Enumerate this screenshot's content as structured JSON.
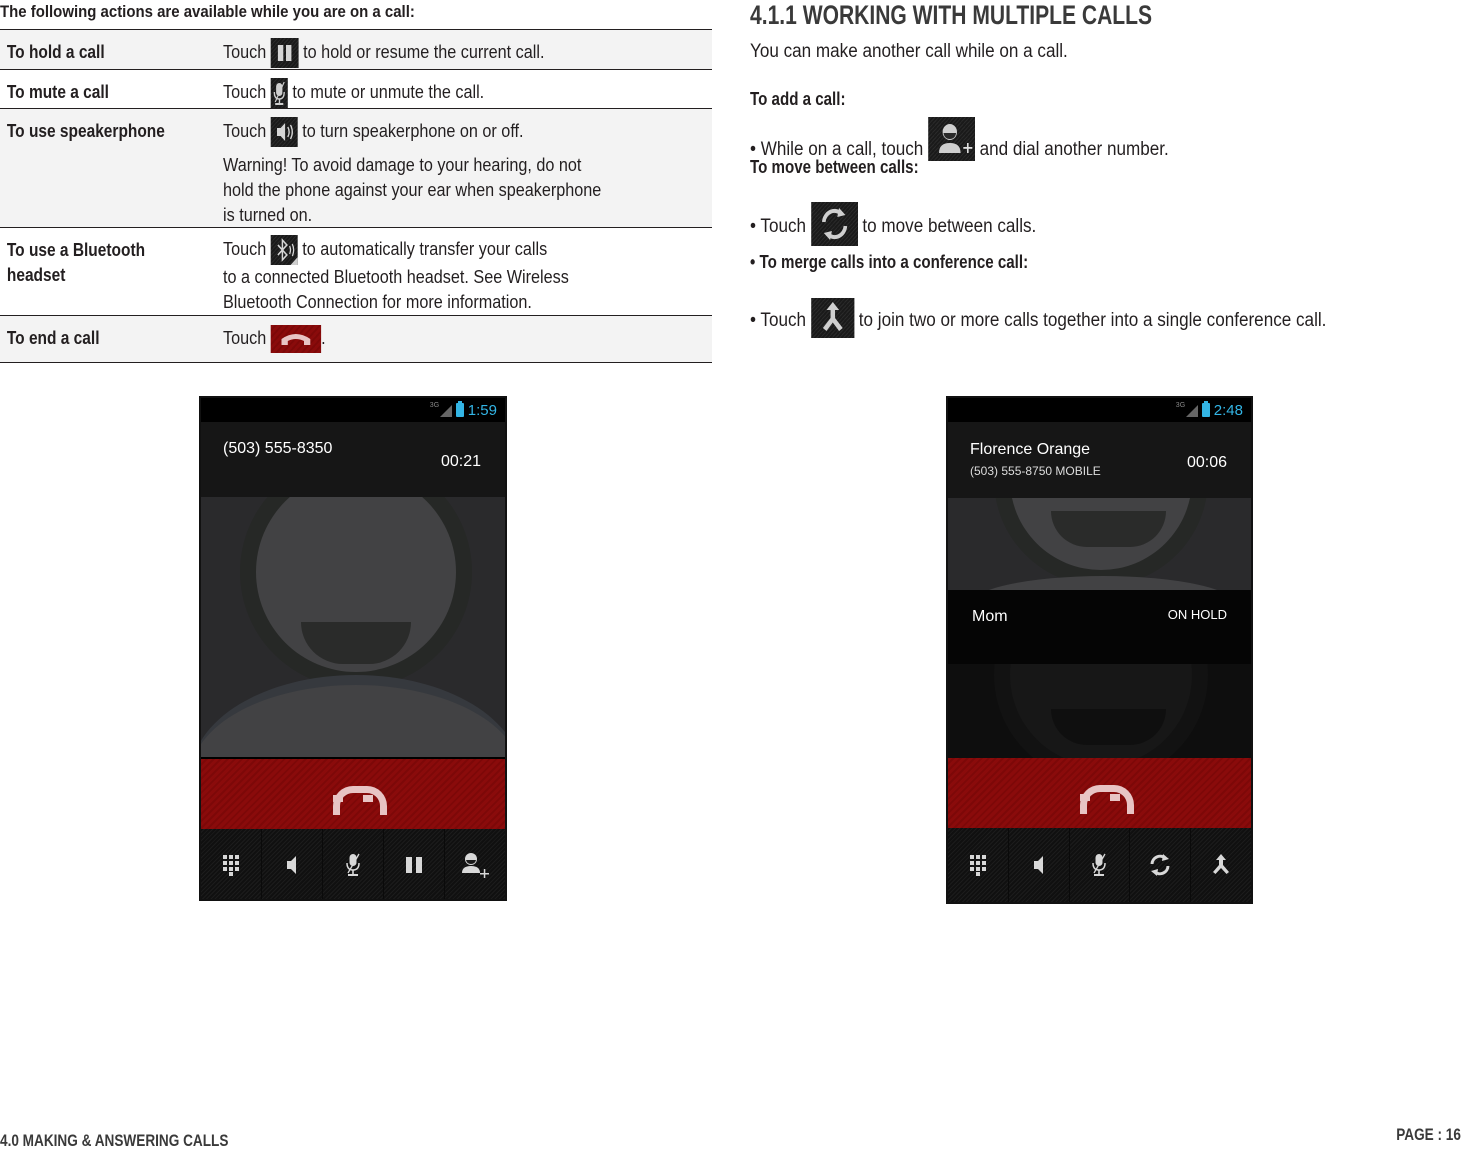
{
  "intro": {
    "heading": "The following actions are available while you are on a call:"
  },
  "actions": [
    {
      "label": "To hold a call",
      "before": "Touch",
      "icon": "pause-icon",
      "after": "to hold or resume the current call."
    },
    {
      "label": "To mute a call",
      "before": "Touch",
      "icon": "microphone-mute-icon",
      "after": "to mute or unmute the call."
    },
    {
      "label": "To use speakerphone",
      "before": "Touch",
      "icon": "speaker-icon",
      "after": "to turn speakerphone on or off.",
      "warning_lines": [
        "Warning! To avoid damage to your hearing, do not",
        "hold the phone against your ear when speakerphone",
        "is turned on."
      ]
    },
    {
      "label_lines": [
        "To use a Bluetooth",
        "headset"
      ],
      "before": "Touch",
      "icon": "bluetooth-icon",
      "after": "to automatically transfer your calls",
      "more_lines": [
        "to a connected Bluetooth headset. See Wireless",
        "Bluetooth Connection for more information."
      ]
    },
    {
      "label": "To end a call",
      "before": "Touch",
      "icon": "end-call-icon",
      "after": "."
    }
  ],
  "section": {
    "title": "4.1.1 WORKING WITH MULTIPLE CALLS",
    "intro": "You can make another call while on a call.",
    "add_call_heading": "To add a call:",
    "add_call_before": "• While on a call, touch",
    "add_call_after": "and dial another number.",
    "move_heading": "To move between calls:",
    "move_before": "• Touch",
    "move_after": "to move between calls.",
    "merge_heading": "• To merge calls into a conference call:",
    "merge_before": "• Touch",
    "merge_after": "to join two or more calls together into a single conference call."
  },
  "phone1": {
    "status": {
      "network": "3G",
      "time": "1:59"
    },
    "caller": "(503) 555-8350",
    "timer": "00:21",
    "controls": [
      "dialpad-icon",
      "speaker-icon",
      "microphone-mute-icon",
      "pause-icon",
      "add-call-icon"
    ]
  },
  "phone2": {
    "status": {
      "network": "3G",
      "time": "2:48"
    },
    "caller": "Florence Orange",
    "caller_sub": "(503) 555-8750  MOBILE",
    "timer": "00:06",
    "held_caller": "Mom",
    "held_status": "ON HOLD",
    "controls": [
      "dialpad-icon",
      "speaker-icon",
      "microphone-mute-icon",
      "swap-calls-icon",
      "merge-calls-icon"
    ]
  },
  "footer": {
    "chapter": "4.0 MAKING & ANSWERING CALLS",
    "page": "PAGE : 16"
  },
  "colors": {
    "end_call_red": "#8a0b0b",
    "status_blue": "#33b5e5",
    "row_shade": "#f3f3f3"
  }
}
